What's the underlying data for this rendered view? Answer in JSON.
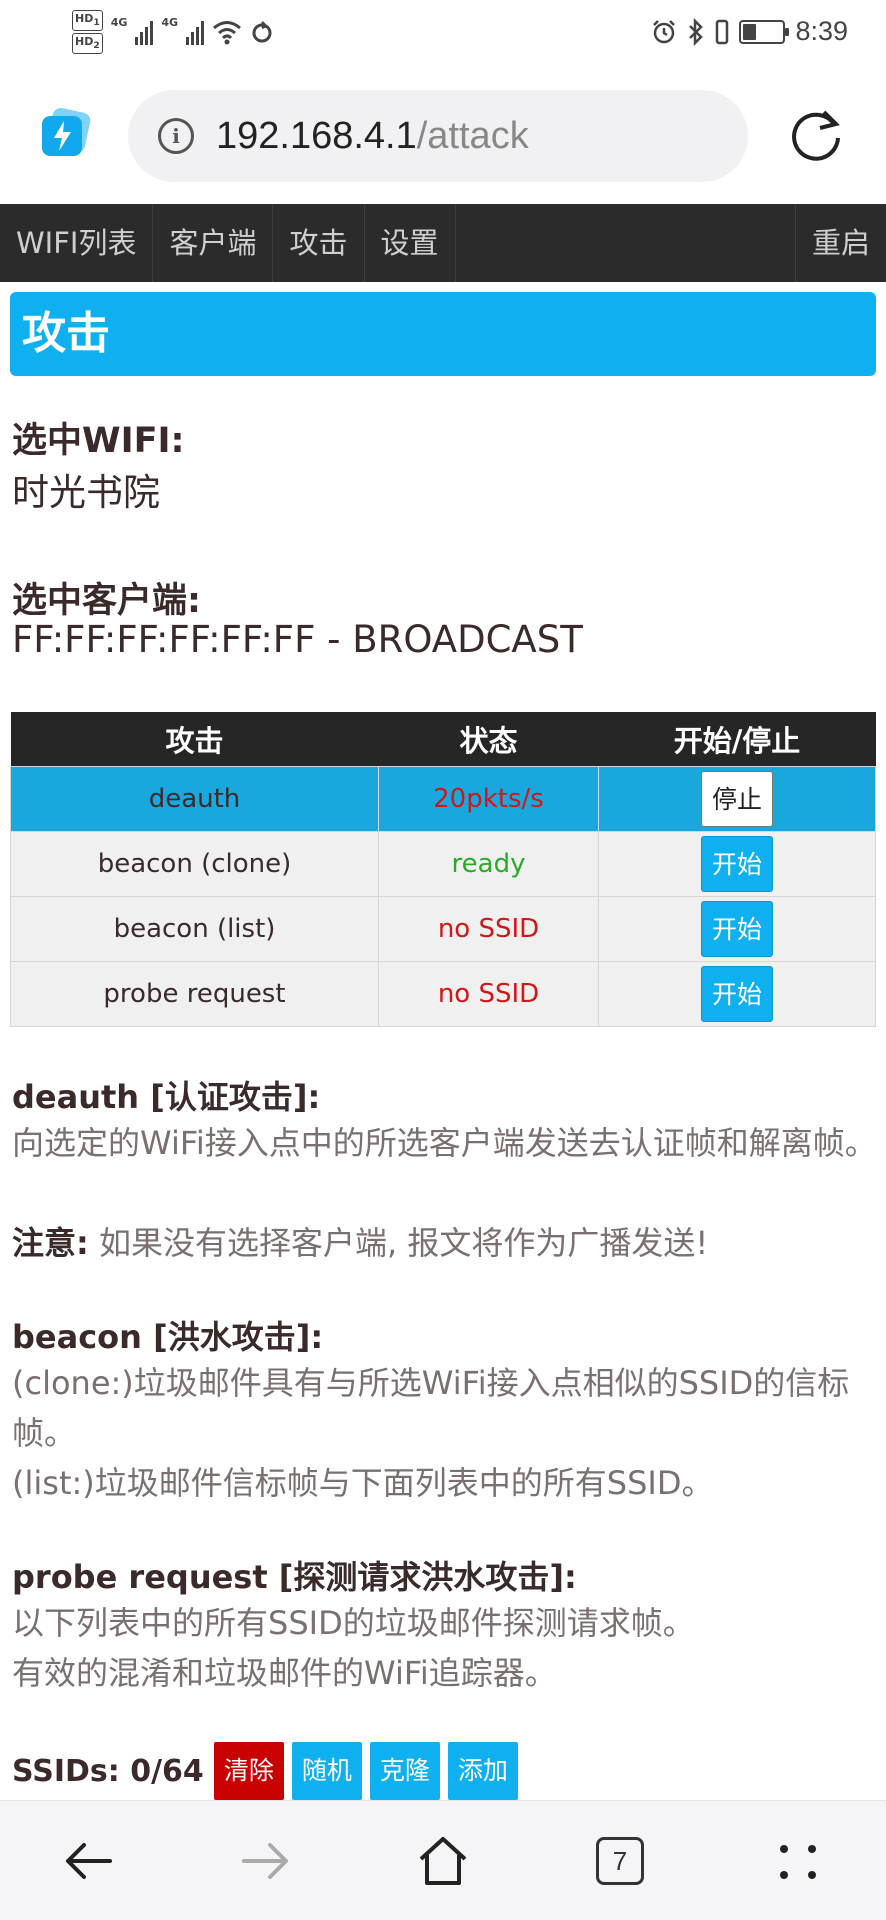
{
  "status_bar": {
    "hd1": "HD",
    "hd1_sub": "1",
    "hd2": "HD",
    "hd2_sub": "2",
    "net1": "4G",
    "net2": "4G",
    "time": "8:39",
    "battery_level": 0.35
  },
  "browser": {
    "url_host": "192.168.4.1",
    "url_path": "/attack",
    "tab_count": "7"
  },
  "nav": {
    "items": [
      "WIFI列表",
      "客户端",
      "攻击",
      "设置"
    ],
    "right": "重启"
  },
  "page": {
    "title": "攻击",
    "selected_wifi_label": "选中WIFI:",
    "selected_wifi_value": "时光书院",
    "selected_client_label": "选中客户端:",
    "selected_client_value": "FF:FF:FF:FF:FF:FF - BROADCAST"
  },
  "table": {
    "headers": [
      "攻击",
      "状态",
      "开始/停止"
    ],
    "rows": [
      {
        "name": "deauth",
        "status": "20pkts/s",
        "button": "停止"
      },
      {
        "name": "beacon (clone)",
        "status": "ready",
        "button": "开始"
      },
      {
        "name": "beacon (list)",
        "status": "no SSID",
        "button": "开始"
      },
      {
        "name": "probe request",
        "status": "no SSID",
        "button": "开始"
      }
    ]
  },
  "descriptions": {
    "deauth_title": "deauth [认证攻击]:",
    "deauth_text": "向选定的WiFi接入点中的所选客户端发送去认证帧和解离帧。",
    "note_label": "注意:",
    "note_text": " 如果没有选择客户端, 报文将作为广播发送!",
    "beacon_title": "beacon [洪水攻击]:",
    "beacon_clone": "(clone:)垃圾邮件具有与所选WiFi接入点相似的SSID的信标帧。",
    "beacon_list": "(list:)垃圾邮件信标帧与下面列表中的所有SSID。",
    "probe_title": "probe request [探测请求洪水攻击]:",
    "probe_text1": "以下列表中的所有SSID的垃圾邮件探测请求帧。",
    "probe_text2": "有效的混淆和垃圾邮件的WiFi追踪器。"
  },
  "ssids": {
    "label": "SSIDs: 0/64",
    "clear": "清除",
    "random": "随机",
    "clone": "克隆",
    "add": "添加"
  },
  "colors": {
    "accent": "#0fb0f0",
    "nav_bg": "#2b2b2b",
    "danger": "#c80000",
    "status_red": "#d01818",
    "status_green": "#2aaa2a"
  }
}
